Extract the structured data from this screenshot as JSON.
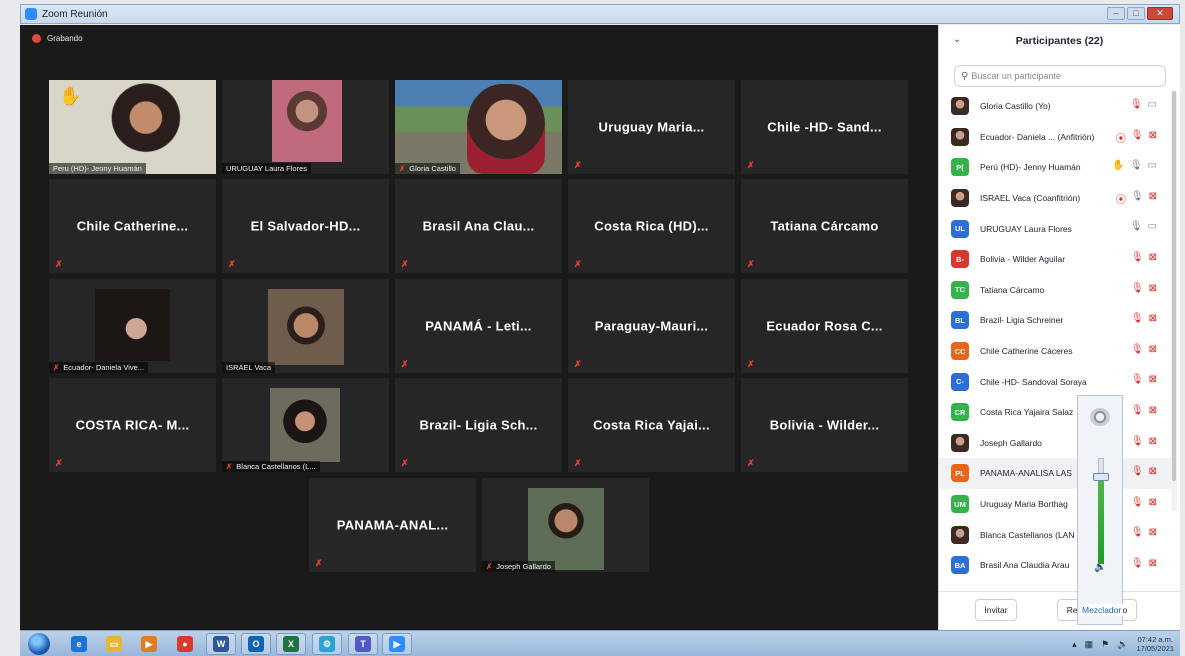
{
  "window": {
    "title": "Zoom Reunión"
  },
  "meeting": {
    "recording_label": "Grabando",
    "tiles": [
      {
        "label": "Peru (HD)- Jenny Huamán",
        "kind": "video",
        "video": "v-jenny",
        "hand": true,
        "active": true
      },
      {
        "label": "URUGUAY Laura Flores",
        "kind": "video",
        "video": "v-laura"
      },
      {
        "label": "Gloria Castillo",
        "kind": "video",
        "video": "v-gloria",
        "muted_label": true
      },
      {
        "name": "Uruguay Maria...",
        "kind": "name"
      },
      {
        "name": "Chile -HD- Sand...",
        "kind": "name"
      },
      {
        "name": "Chile Catherine...",
        "kind": "name"
      },
      {
        "name": "El Salvador-HD...",
        "kind": "name"
      },
      {
        "name": "Brasil Ana Clau...",
        "kind": "name"
      },
      {
        "name": "Costa Rica (HD)...",
        "kind": "name"
      },
      {
        "name": "Tatiana Cárcamo",
        "kind": "name"
      },
      {
        "label": "Ecuador- Daniela Vive...",
        "kind": "video",
        "video": "v-daniela",
        "muted_label": true
      },
      {
        "label": "ISRAEL Vaca",
        "kind": "video",
        "video": "v-israel"
      },
      {
        "name": "PANAMÁ - Leti...",
        "kind": "name"
      },
      {
        "name": "Paraguay-Mauri...",
        "kind": "name"
      },
      {
        "name": "Ecuador Rosa C...",
        "kind": "name"
      },
      {
        "name": "COSTA RICA- M...",
        "kind": "name"
      },
      {
        "label": "Blanca Castellanos (L...",
        "kind": "video",
        "video": "v-blanca",
        "muted_label": true
      },
      {
        "name": "Brazil- Ligia Sch...",
        "kind": "name"
      },
      {
        "name": "Costa Rica Yajai...",
        "kind": "name"
      },
      {
        "name": "Bolivia - Wilder...",
        "kind": "name"
      },
      {
        "name": "PANAMA-ANAL...",
        "kind": "name"
      },
      {
        "label": "Joseph Gallardo",
        "kind": "video",
        "video": "v-joseph",
        "muted_label": true
      }
    ]
  },
  "participants": {
    "title": "Participantes (22)",
    "search_placeholder": "Buscar un participante",
    "items": [
      {
        "name": "Gloria Castillo (Yo)",
        "avatar": "",
        "photo": true,
        "icons": [
          "mic-off",
          "cam-on"
        ]
      },
      {
        "name": "Ecuador- Daniela ... (Anfitrión)",
        "avatar": "",
        "photo": true,
        "icons": [
          "share",
          "mic-off",
          "cam-off"
        ]
      },
      {
        "name": "Perú (HD)- Jenny Huamán",
        "avatar": "P(",
        "color": "#35b24a",
        "icons": [
          "hand",
          "mic-on",
          "cam-on"
        ]
      },
      {
        "name": "ISRAEL Vaca (Coanfitrión)",
        "avatar": "",
        "photo": true,
        "icons": [
          "share",
          "mic-on",
          "cam-off"
        ]
      },
      {
        "name": "URUGUAY Laura Flores",
        "avatar": "UL",
        "color": "#2d6fd6",
        "icons": [
          "mic-on",
          "cam-on"
        ]
      },
      {
        "name": "Bolivia - Wilder Aguilar",
        "avatar": "B-",
        "color": "#d33a2c",
        "icons": [
          "mic-off",
          "cam-off"
        ]
      },
      {
        "name": "Tatiana Cárcamo",
        "avatar": "TC",
        "color": "#35b24a",
        "icons": [
          "mic-off",
          "cam-off"
        ]
      },
      {
        "name": "Brazil- Ligia Schreiner",
        "avatar": "BL",
        "color": "#2d6fd6",
        "icons": [
          "mic-off",
          "cam-off"
        ]
      },
      {
        "name": "Chile Catherine Cáceres",
        "avatar": "CC",
        "color": "#e8661a",
        "icons": [
          "mic-off",
          "cam-off"
        ]
      },
      {
        "name": "Chile -HD- Sandoval Soraya",
        "avatar": "C-",
        "color": "#2d6fd6",
        "icons": [
          "mic-off",
          "cam-off"
        ]
      },
      {
        "name": "Costa Rica Yajaira Salaz",
        "avatar": "CR",
        "color": "#35b24a",
        "icons": [
          "mic-off",
          "cam-off"
        ]
      },
      {
        "name": "Joseph Gallardo",
        "avatar": "",
        "photo": true,
        "icons": [
          "mic-off",
          "cam-off"
        ]
      },
      {
        "name": "PANAMA-ANALISA LAS",
        "avatar": "PL",
        "color": "#e8661a",
        "icons": [
          "mic-off",
          "cam-off"
        ],
        "selected": true
      },
      {
        "name": "Uruguay Maria Borthag",
        "avatar": "UM",
        "color": "#35b24a",
        "icons": [
          "mic-off",
          "cam-off"
        ]
      },
      {
        "name": "Blanca Castellanos (LAN",
        "avatar": "",
        "photo": true,
        "icons": [
          "mic-off",
          "cam-off"
        ]
      },
      {
        "name": "Brasil Ana Claudia Arau",
        "avatar": "BA",
        "color": "#2d6fd6",
        "icons": [
          "mic-off",
          "cam-off"
        ]
      }
    ],
    "invite_label": "Invitar",
    "reaction_label": "Reac",
    "reaction_tail": "o"
  },
  "mixer": {
    "label": "Mezclador",
    "level": 0.82
  },
  "taskbar": {
    "time": "07:42 a.m.",
    "date": "17/05/2021",
    "items": [
      {
        "icon": "internet-explorer-icon",
        "glyph": "e",
        "color": "#1e73d8"
      },
      {
        "icon": "file-explorer-icon",
        "glyph": "▭",
        "color": "#e6b636"
      },
      {
        "icon": "media-player-icon",
        "glyph": "▶",
        "color": "#e07b1f"
      },
      {
        "icon": "chrome-icon",
        "glyph": "●",
        "color": "#d93a2b"
      },
      {
        "icon": "word-icon",
        "glyph": "W",
        "color": "#2b5797"
      },
      {
        "icon": "outlook-icon",
        "glyph": "O",
        "color": "#0d63b6"
      },
      {
        "icon": "excel-icon",
        "glyph": "X",
        "color": "#1f7244"
      },
      {
        "icon": "app-icon",
        "glyph": "⚙",
        "color": "#2aa1d9"
      },
      {
        "icon": "teams-icon",
        "glyph": "T",
        "color": "#5059c9"
      },
      {
        "icon": "zoom-icon",
        "glyph": "▶",
        "color": "#2d8cff"
      }
    ]
  }
}
